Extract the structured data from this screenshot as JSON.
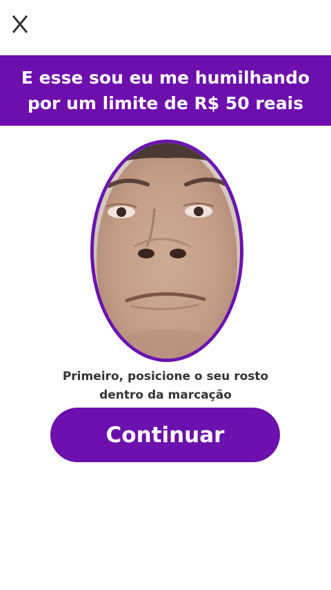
{
  "header": {
    "close_label": "X"
  },
  "banner": {
    "text": "E esse sou eu me humilhando por um limite de R$ 50 reais"
  },
  "camera": {
    "icon": "face-photo"
  },
  "instruction": {
    "text": "Primeiro, posicione o seu rosto\ndentro da marcação"
  },
  "actions": {
    "continue_label": "Continuar"
  },
  "colors": {
    "accent": "#6d0fad",
    "text_dark": "#333333",
    "background": "#fefefe"
  }
}
